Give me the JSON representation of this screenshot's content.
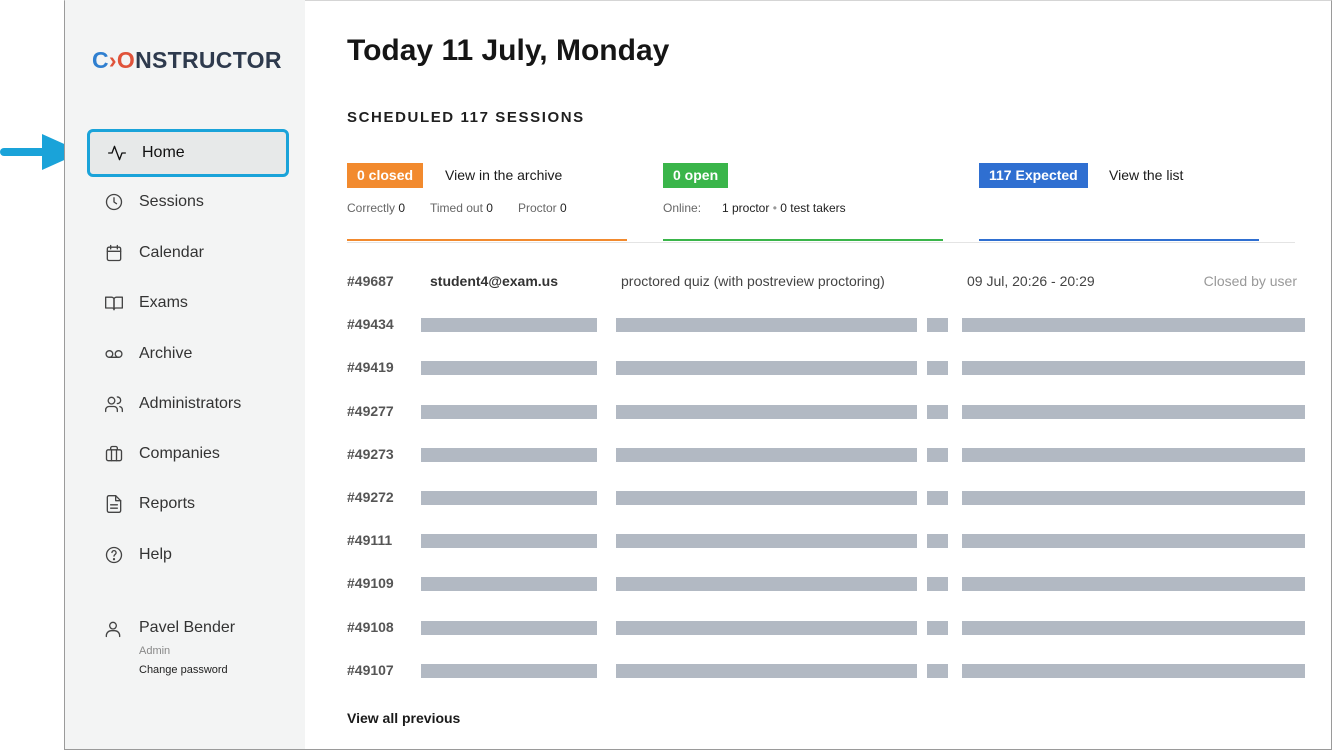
{
  "colors": {
    "accent_orange": "#f28a2e",
    "accent_green": "#3ab54a",
    "accent_blue": "#2f6fd1",
    "highlight": "#1aa3d9",
    "placeholder": "#b2b9c3"
  },
  "logo": {
    "part1": "C",
    "part2": "›O",
    "part3": "NSTRUCTOR"
  },
  "sidebar": {
    "items": [
      {
        "label": "Home",
        "icon": "activity-icon",
        "active": true
      },
      {
        "label": "Sessions",
        "icon": "clock-icon"
      },
      {
        "label": "Calendar",
        "icon": "calendar-icon"
      },
      {
        "label": "Exams",
        "icon": "book-icon"
      },
      {
        "label": "Archive",
        "icon": "voicemail-icon"
      },
      {
        "label": "Administrators",
        "icon": "users-icon"
      },
      {
        "label": "Companies",
        "icon": "briefcase-icon"
      },
      {
        "label": "Reports",
        "icon": "file-icon"
      },
      {
        "label": "Help",
        "icon": "help-icon"
      }
    ],
    "user": {
      "name": "Pavel Bender",
      "role": "Admin",
      "change_password": "Change password"
    }
  },
  "header": {
    "title": "Today 11 July, Monday",
    "scheduled": "SCHEDULED 117 SESSIONS"
  },
  "stats": {
    "closed": {
      "badge": "0 closed",
      "link": "View in the archive",
      "correctly_label": "Correctly",
      "correctly": "0",
      "timed_out_label": "Timed out",
      "timed_out": "0",
      "proctor_label": "Proctor",
      "proctor": "0"
    },
    "open": {
      "badge": "0 open",
      "online_label": "Online:",
      "proctors": "1 proctor",
      "sep": "•",
      "takers": "0 test takers"
    },
    "expected": {
      "badge": "117 Expected",
      "link": "View the list"
    }
  },
  "sessions": {
    "first": {
      "id": "#49687",
      "email": "student4@exam.us",
      "exam": "proctored quiz (with postreview proctoring)",
      "time": "09 Jul, 20:26 - 20:29",
      "status": "Closed by user"
    },
    "ids": [
      "#49434",
      "#49419",
      "#49277",
      "#49273",
      "#49272",
      "#49111",
      "#49109",
      "#49108",
      "#49107"
    ]
  },
  "footer": {
    "view_all": "View all previous"
  }
}
